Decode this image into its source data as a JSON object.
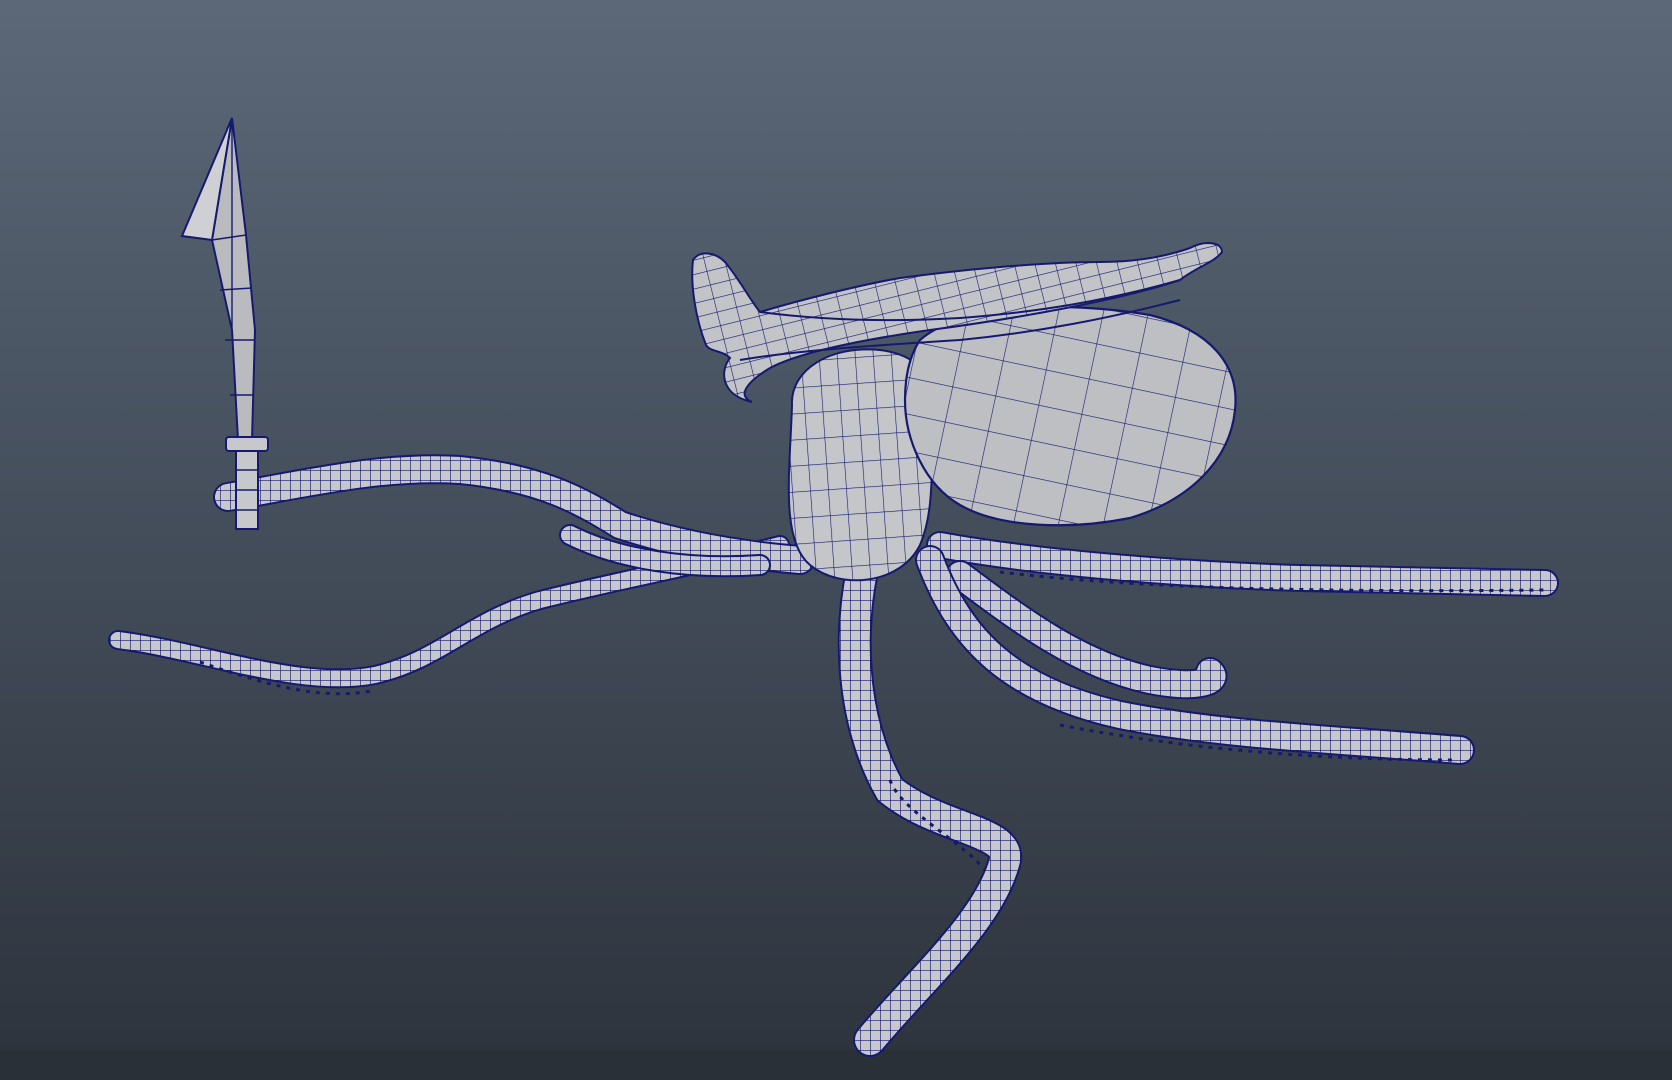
{
  "viewport": {
    "label": "",
    "background_top": "#5c6878",
    "background_bottom": "#2d333c",
    "mesh_fill": "#c6c8cc",
    "wire_color": "#161a6e",
    "shading": "wireframe-on-shaded"
  },
  "model": {
    "name": "",
    "parts": [
      {
        "name": "octopus-head"
      },
      {
        "name": "pirate-hat"
      },
      {
        "name": "tentacle"
      },
      {
        "name": "sword"
      }
    ]
  }
}
